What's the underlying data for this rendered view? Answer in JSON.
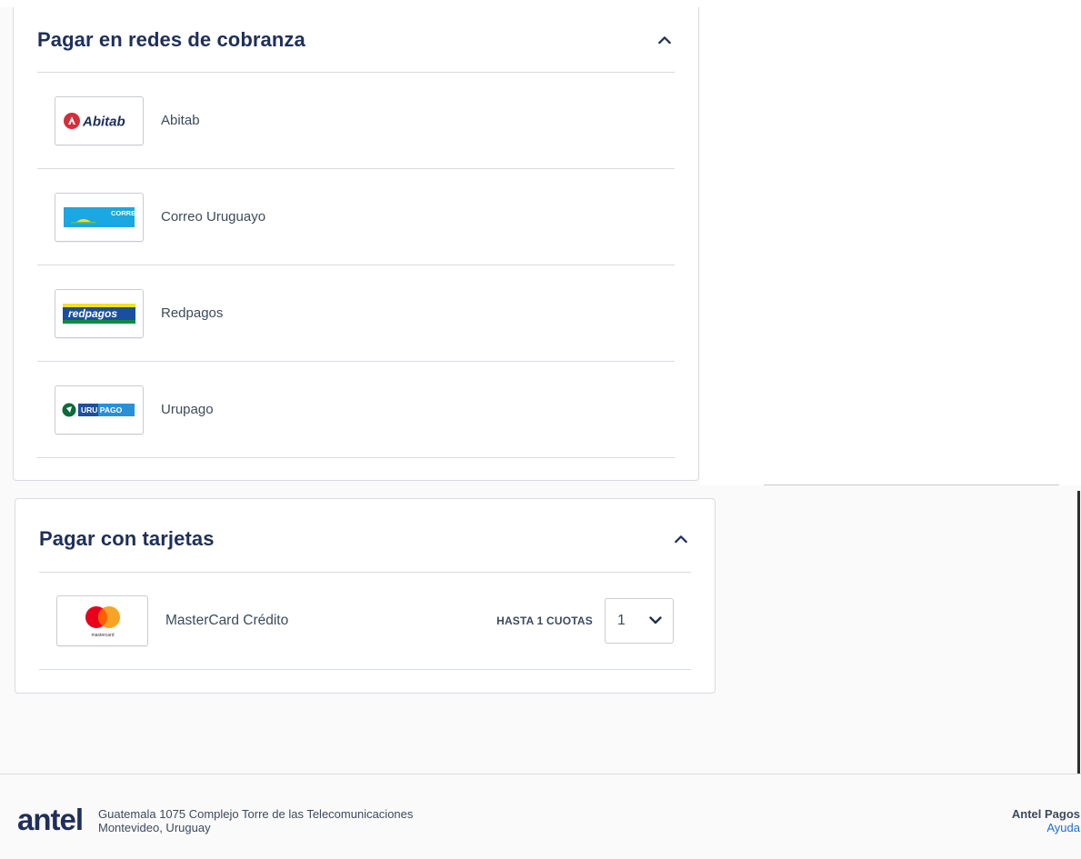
{
  "redes": {
    "title": "Pagar en redes de cobranza",
    "methods": [
      {
        "label": "Abitab",
        "logo_text": "Abitab"
      },
      {
        "label": "Correo Uruguayo",
        "logo_text": "CORREO"
      },
      {
        "label": "Redpagos",
        "logo_text": "redpagos"
      },
      {
        "label": "Urupago",
        "logo_text": "URU PAGO"
      }
    ]
  },
  "tarjetas": {
    "title": "Pagar con tarjetas",
    "card": {
      "label": "MasterCard Crédito",
      "logo_text": "mastercard",
      "cuotas_label": "HASTA 1 CUOTAS",
      "cuotas_value": "1"
    }
  },
  "footer": {
    "logo": "antel",
    "address_line1": "Guatemala 1075 Complejo Torre de las Telecomunicaciones",
    "address_line2": "Montevideo, Uruguay",
    "brand": "Antel Pagos",
    "help": "Ayuda"
  },
  "colors": {
    "title": "#1e2f5a",
    "text": "#3d4a5c",
    "border": "#d8dbe0",
    "abitab_red": "#d62d3a",
    "correo_blue": "#1aa7e2",
    "redpagos_blue": "#1a4fa0",
    "redpagos_yellow": "#f2e125",
    "urupago_green": "#0b6b3a",
    "mastercard_red": "#eb001b",
    "mastercard_orange": "#f79e1b",
    "link": "#1e6fd0"
  }
}
